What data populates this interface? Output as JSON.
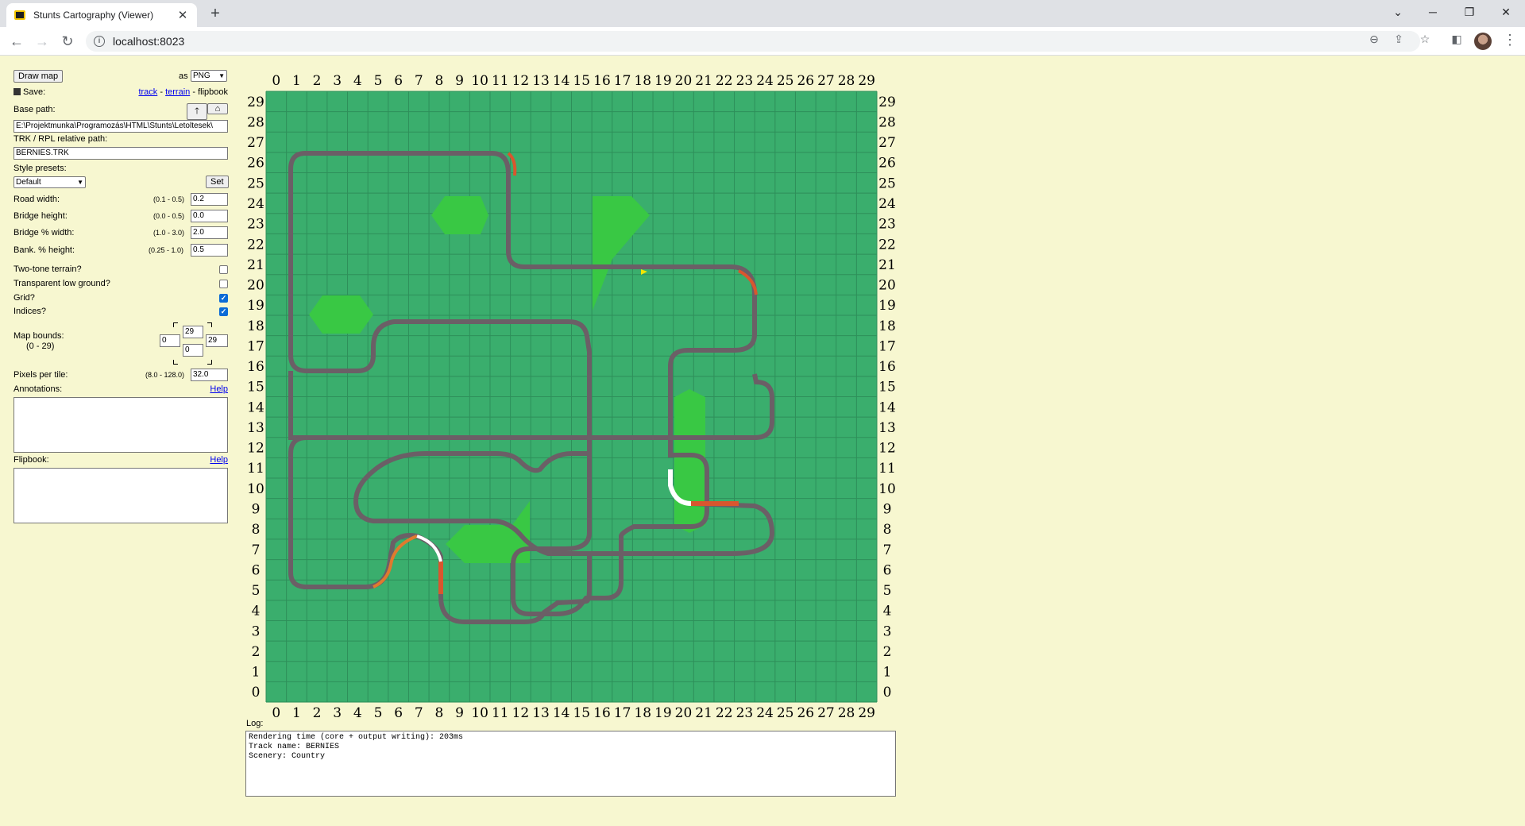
{
  "browser": {
    "tab_title": "Stunts Cartography (Viewer)",
    "url": "localhost:8023",
    "new_tab": "+",
    "tab_close": "✕"
  },
  "controls": {
    "draw_map_button": "Draw map",
    "as_label": "as",
    "format_value": "PNG",
    "save_label": "Save:",
    "save_track_link": "track",
    "save_terrain_link": "terrain",
    "save_flipbook_label": "flipbook",
    "save_sep1": "-",
    "save_sep2": "-",
    "base_path_label": "Base path:",
    "base_path_value": "E:\\Projektmunka\\Programozás\\HTML\\Stunts\\Letoltesek\\",
    "trk_label": "TRK / RPL relative path:",
    "trk_value": "BERNIES.TRK",
    "style_presets_label": "Style presets:",
    "style_preset_value": "Default",
    "set_button": "Set",
    "road_width_label": "Road width:",
    "road_width_range": "(0.1 - 0.5)",
    "road_width_value": "0.2",
    "bridge_height_label": "Bridge height:",
    "bridge_height_range": "(0.0 - 0.5)",
    "bridge_height_value": "0.0",
    "bridge_width_label": "Bridge % width:",
    "bridge_width_range": "(1.0 - 3.0)",
    "bridge_width_value": "2.0",
    "bank_height_label": "Bank. % height:",
    "bank_height_range": "(0.25 - 1.0)",
    "bank_height_value": "0.5",
    "two_tone_label": "Two-tone terrain?",
    "two_tone_checked": false,
    "transparent_label": "Transparent low ground?",
    "transparent_checked": false,
    "grid_label": "Grid?",
    "grid_checked": true,
    "indices_label": "Indices?",
    "indices_checked": true,
    "map_bounds_label": "Map bounds:",
    "map_bounds_range": "(0 - 29)",
    "bound_top": "29",
    "bound_left": "0",
    "bound_right": "29",
    "bound_bottom": "0",
    "pixels_per_tile_label": "Pixels per tile:",
    "pixels_per_tile_range": "(8.0 - 128.0)",
    "pixels_per_tile_value": "32.0",
    "annotations_label": "Annotations:",
    "annotations_help": "Help",
    "flipbook_label": "Flipbook:",
    "flipbook_help": "Help"
  },
  "map": {
    "size": 30,
    "grid_color": "#2e8f5a",
    "terrain_color": "#3aae6d",
    "hill_color": "#39c844",
    "road_color": "#6b5f66",
    "bank_color": "#d9562e"
  },
  "log": {
    "label": "Log:",
    "text": "Rendering time (core + output writing): 203ms\nTrack name: BERNIES\nScenery: Country"
  }
}
